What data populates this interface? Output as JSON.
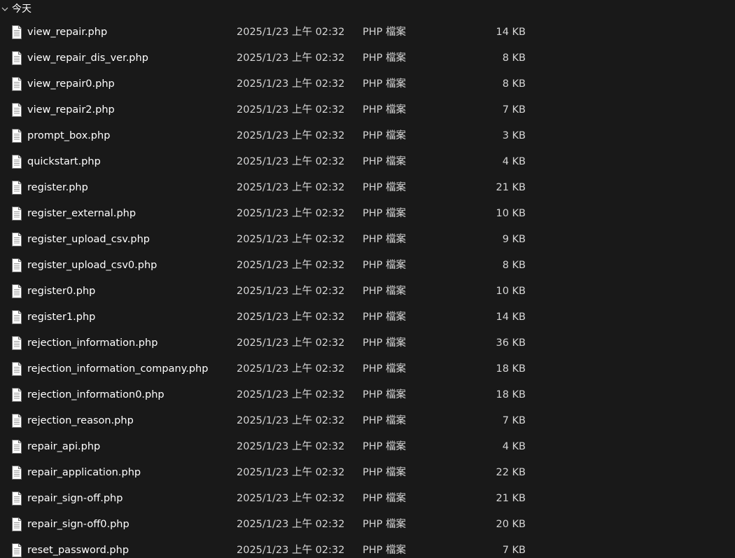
{
  "group": {
    "label": "今天",
    "icon": "chevron-down-icon"
  },
  "colors": {
    "background": "#191919",
    "text": "#ffffff",
    "secondary_text": "#d6d6d6"
  },
  "files": [
    {
      "name": "view_repair.php",
      "date": "2025/1/23 上午 02:32",
      "type": "PHP 檔案",
      "size": "14 KB"
    },
    {
      "name": "view_repair_dis_ver.php",
      "date": "2025/1/23 上午 02:32",
      "type": "PHP 檔案",
      "size": "8 KB"
    },
    {
      "name": "view_repair0.php",
      "date": "2025/1/23 上午 02:32",
      "type": "PHP 檔案",
      "size": "8 KB"
    },
    {
      "name": "view_repair2.php",
      "date": "2025/1/23 上午 02:32",
      "type": "PHP 檔案",
      "size": "7 KB"
    },
    {
      "name": "prompt_box.php",
      "date": "2025/1/23 上午 02:32",
      "type": "PHP 檔案",
      "size": "3 KB"
    },
    {
      "name": "quickstart.php",
      "date": "2025/1/23 上午 02:32",
      "type": "PHP 檔案",
      "size": "4 KB"
    },
    {
      "name": "register.php",
      "date": "2025/1/23 上午 02:32",
      "type": "PHP 檔案",
      "size": "21 KB"
    },
    {
      "name": "register_external.php",
      "date": "2025/1/23 上午 02:32",
      "type": "PHP 檔案",
      "size": "10 KB"
    },
    {
      "name": "register_upload_csv.php",
      "date": "2025/1/23 上午 02:32",
      "type": "PHP 檔案",
      "size": "9 KB"
    },
    {
      "name": "register_upload_csv0.php",
      "date": "2025/1/23 上午 02:32",
      "type": "PHP 檔案",
      "size": "8 KB"
    },
    {
      "name": "register0.php",
      "date": "2025/1/23 上午 02:32",
      "type": "PHP 檔案",
      "size": "10 KB"
    },
    {
      "name": "register1.php",
      "date": "2025/1/23 上午 02:32",
      "type": "PHP 檔案",
      "size": "14 KB"
    },
    {
      "name": "rejection_information.php",
      "date": "2025/1/23 上午 02:32",
      "type": "PHP 檔案",
      "size": "36 KB"
    },
    {
      "name": "rejection_information_company.php",
      "date": "2025/1/23 上午 02:32",
      "type": "PHP 檔案",
      "size": "18 KB"
    },
    {
      "name": "rejection_information0.php",
      "date": "2025/1/23 上午 02:32",
      "type": "PHP 檔案",
      "size": "18 KB"
    },
    {
      "name": "rejection_reason.php",
      "date": "2025/1/23 上午 02:32",
      "type": "PHP 檔案",
      "size": "7 KB"
    },
    {
      "name": "repair_api.php",
      "date": "2025/1/23 上午 02:32",
      "type": "PHP 檔案",
      "size": "4 KB"
    },
    {
      "name": "repair_application.php",
      "date": "2025/1/23 上午 02:32",
      "type": "PHP 檔案",
      "size": "22 KB"
    },
    {
      "name": "repair_sign-off.php",
      "date": "2025/1/23 上午 02:32",
      "type": "PHP 檔案",
      "size": "21 KB"
    },
    {
      "name": "repair_sign-off0.php",
      "date": "2025/1/23 上午 02:32",
      "type": "PHP 檔案",
      "size": "20 KB"
    },
    {
      "name": "reset_password.php",
      "date": "2025/1/23 上午 02:32",
      "type": "PHP 檔案",
      "size": "7 KB"
    }
  ]
}
